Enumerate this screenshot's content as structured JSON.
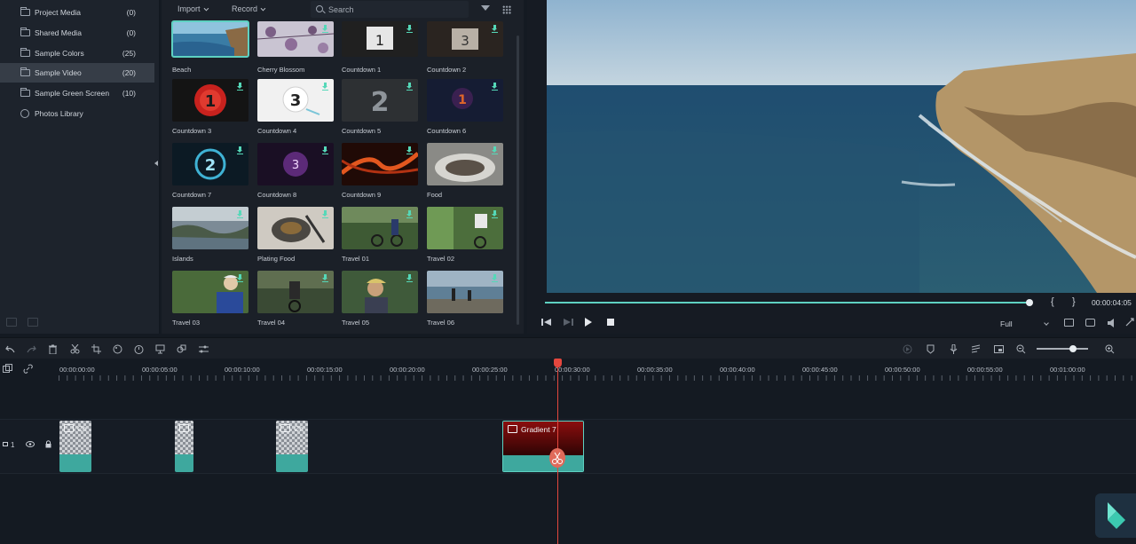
{
  "sidebar": {
    "items": [
      {
        "label": "Project Media",
        "count": "(0)",
        "icon": "folder-icon"
      },
      {
        "label": "Shared Media",
        "count": "(0)",
        "icon": "folder-icon"
      },
      {
        "label": "Sample Colors",
        "count": "(25)",
        "icon": "folder-icon"
      },
      {
        "label": "Sample Video",
        "count": "(20)",
        "icon": "folder-icon",
        "selected": true
      },
      {
        "label": "Sample Green Screen",
        "count": "(10)",
        "icon": "folder-icon"
      },
      {
        "label": "Photos Library",
        "count": "",
        "icon": "globe-icon"
      }
    ]
  },
  "media": {
    "toolbar": {
      "import": "Import",
      "record": "Record",
      "search_placeholder": "Search"
    },
    "items": [
      {
        "label": "Beach"
      },
      {
        "label": "Cherry Blossom"
      },
      {
        "label": "Countdown 1"
      },
      {
        "label": "Countdown 2"
      },
      {
        "label": "Countdown 3"
      },
      {
        "label": "Countdown 4"
      },
      {
        "label": "Countdown 5"
      },
      {
        "label": "Countdown 6"
      },
      {
        "label": "Countdown 7"
      },
      {
        "label": "Countdown 8"
      },
      {
        "label": "Countdown 9"
      },
      {
        "label": "Food"
      },
      {
        "label": "Islands"
      },
      {
        "label": "Plating Food"
      },
      {
        "label": "Travel 01"
      },
      {
        "label": "Travel 02"
      },
      {
        "label": "Travel 03"
      },
      {
        "label": "Travel 04"
      },
      {
        "label": "Travel 05"
      },
      {
        "label": "Travel 06"
      }
    ],
    "countdown_digits": {
      "c1": "1",
      "c2": "3",
      "c3": "1",
      "c4": "3",
      "c5": "2",
      "c6": "1",
      "c7": "2",
      "c8": "3"
    }
  },
  "preview": {
    "time": "00:00:04:05",
    "progress": 0.99,
    "quality": "Full",
    "mark_in": "{",
    "mark_out": "}"
  },
  "timeline": {
    "ruler": [
      "00:00:00:00",
      "00:00:05:00",
      "00:00:10:00",
      "00:00:15:00",
      "00:00:20:00",
      "00:00:25:00",
      "00:00:30:00",
      "00:00:35:00",
      "00:00:40:00",
      "00:00:45:00",
      "00:00:50:00",
      "00:00:55:00",
      "00:01:00:00"
    ],
    "track_number": "1",
    "clips": [
      {
        "label": "Ch"
      },
      {
        "label": ""
      },
      {
        "label": "Ch"
      },
      {
        "label": "Gradient 7"
      }
    ]
  },
  "colors": {
    "accent": "#5ed1c1",
    "playhead": "#e4473e",
    "clip": "#3ea89e"
  }
}
